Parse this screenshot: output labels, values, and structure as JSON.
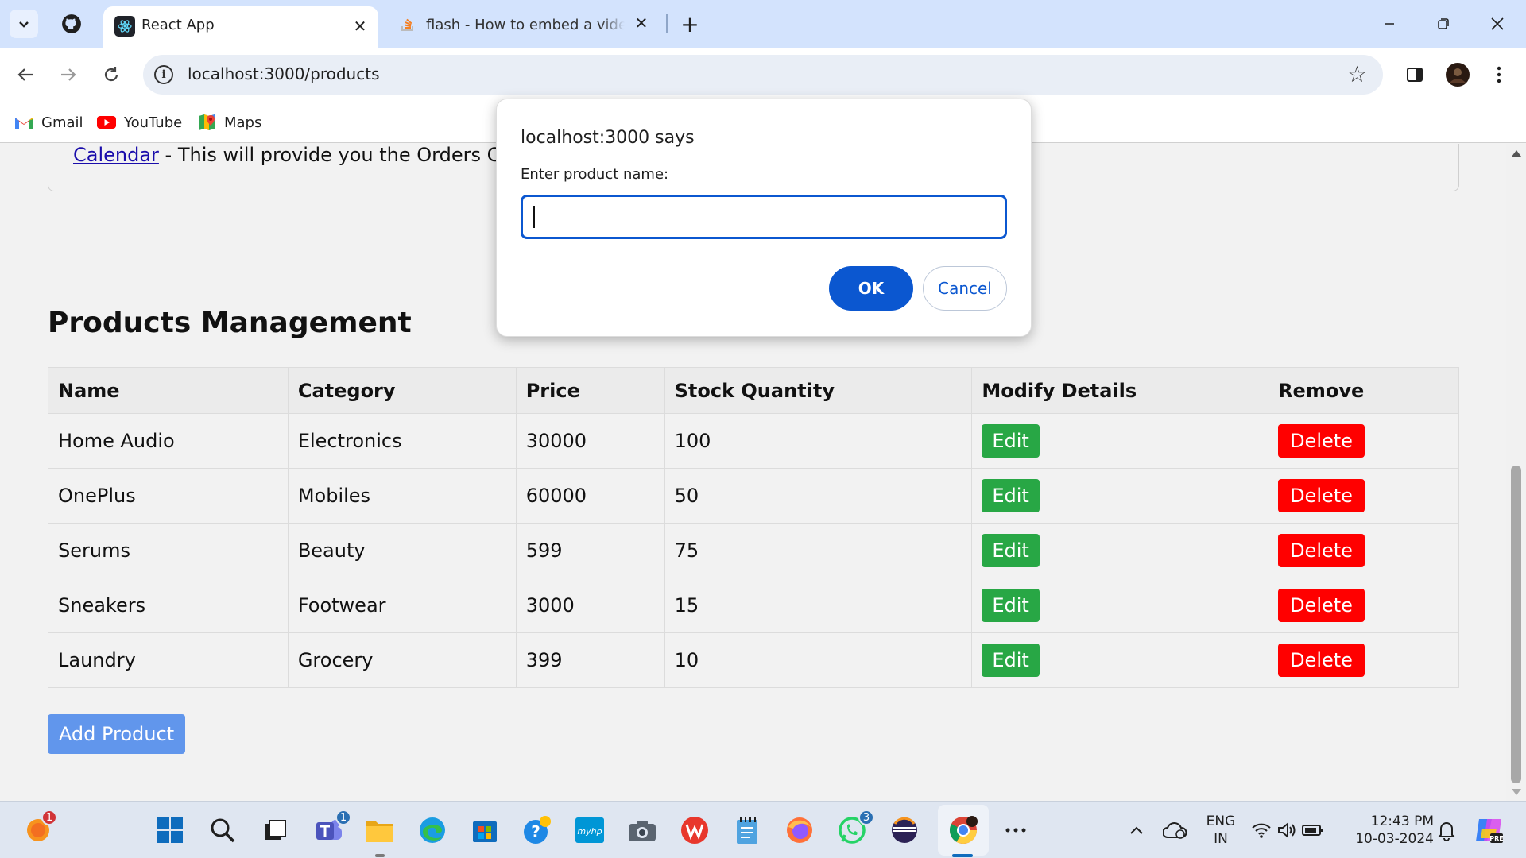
{
  "browser": {
    "tabs": [
      {
        "title": "React App",
        "active": true
      },
      {
        "title": "flash - How to embed a video i",
        "active": false
      }
    ],
    "url": "localhost:3000/products",
    "bookmarks": [
      {
        "label": "Gmail",
        "icon": "gmail-icon"
      },
      {
        "label": "YouTube",
        "icon": "youtube-icon"
      },
      {
        "label": "Maps",
        "icon": "maps-icon"
      }
    ]
  },
  "page": {
    "info_link": "Calendar",
    "info_text": " - This will provide you the Orders Cale",
    "section_title": "Products Management",
    "table": {
      "headers": [
        "Name",
        "Category",
        "Price",
        "Stock Quantity",
        "Modify Details",
        "Remove"
      ],
      "rows": [
        {
          "name": "Home Audio",
          "category": "Electronics",
          "price": "30000",
          "stock": "100"
        },
        {
          "name": "OnePlus",
          "category": "Mobiles",
          "price": "60000",
          "stock": "50"
        },
        {
          "name": "Serums",
          "category": "Beauty",
          "price": "599",
          "stock": "75"
        },
        {
          "name": "Sneakers",
          "category": "Footwear",
          "price": "3000",
          "stock": "15"
        },
        {
          "name": "Laundry",
          "category": "Grocery",
          "price": "399",
          "stock": "10"
        }
      ],
      "edit_label": "Edit",
      "delete_label": "Delete"
    },
    "add_button": "Add Product",
    "colors": {
      "edit": "#28a745",
      "delete": "#ff0000",
      "add": "#6196ec",
      "dialog_accent": "#0b57d0"
    }
  },
  "dialog": {
    "title": "localhost:3000 says",
    "message": "Enter product name:",
    "input_value": "",
    "ok_label": "OK",
    "cancel_label": "Cancel"
  },
  "taskbar": {
    "apps": [
      {
        "icon": "weather-icon",
        "badge": "1"
      },
      {
        "icon": "windows-start-icon"
      },
      {
        "icon": "search-icon"
      },
      {
        "icon": "task-view-icon"
      },
      {
        "icon": "teams-icon",
        "badge": "1"
      },
      {
        "icon": "file-explorer-icon"
      },
      {
        "icon": "edge-icon"
      },
      {
        "icon": "microsoft-store-icon"
      },
      {
        "icon": "get-help-icon"
      },
      {
        "icon": "myhp-icon",
        "label": "myhp"
      },
      {
        "icon": "camera-icon"
      },
      {
        "icon": "wps-office-icon"
      },
      {
        "icon": "notepad-icon"
      },
      {
        "icon": "firefox-icon"
      },
      {
        "icon": "whatsapp-icon",
        "badge": "3"
      },
      {
        "icon": "eclipse-icon"
      },
      {
        "icon": "chrome-icon",
        "active": true
      },
      {
        "icon": "more-apps-icon"
      }
    ],
    "tray": {
      "language": "ENG",
      "region": "IN",
      "time": "12:43 PM",
      "date": "10-03-2024"
    }
  }
}
